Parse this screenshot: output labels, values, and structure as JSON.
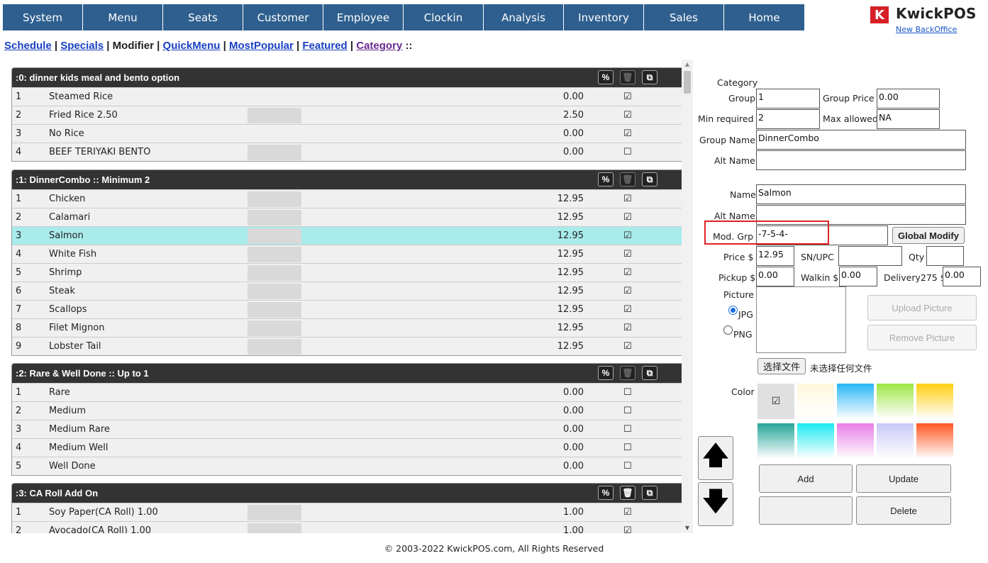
{
  "nav": [
    "System",
    "Menu",
    "Seats",
    "Customer",
    "Employee",
    "Clockin",
    "Analysis",
    "Inventory",
    "Sales",
    "Home"
  ],
  "logo": {
    "mark": "K",
    "name": "KwickPOS",
    "link": "New BackOffice"
  },
  "subnav": {
    "schedule": "Schedule",
    "specials": "Specials",
    "modifier": "Modifier",
    "quickmenu": "QuickMenu",
    "mostpopular": "MostPopular",
    "featured": "Featured",
    "category": "Category",
    "sep": "|",
    "tail": "::"
  },
  "groups": [
    {
      "title": ":0: dinner kids meal and bento option",
      "trash_enabled": false,
      "rows": [
        {
          "num": "1",
          "name": "Steamed Rice",
          "price": "0.00",
          "checked": true,
          "swatch": false
        },
        {
          "num": "2",
          "name": "Fried Rice 2.50",
          "price": "2.50",
          "checked": true,
          "swatch": true
        },
        {
          "num": "3",
          "name": "No Rice",
          "price": "0.00",
          "checked": true,
          "swatch": false
        },
        {
          "num": "4",
          "name": "BEEF TERIYAKI BENTO",
          "price": "0.00",
          "checked": false,
          "swatch": true
        }
      ]
    },
    {
      "title": ":1: DinnerCombo :: Minimum 2",
      "trash_enabled": false,
      "rows": [
        {
          "num": "1",
          "name": "Chicken",
          "price": "12.95",
          "checked": true,
          "swatch": true
        },
        {
          "num": "2",
          "name": "Calamari",
          "price": "12.95",
          "checked": true,
          "swatch": true
        },
        {
          "num": "3",
          "name": "Salmon",
          "price": "12.95",
          "checked": true,
          "swatch": true,
          "selected": true
        },
        {
          "num": "4",
          "name": "White Fish",
          "price": "12.95",
          "checked": true,
          "swatch": true
        },
        {
          "num": "5",
          "name": "Shrimp",
          "price": "12.95",
          "checked": true,
          "swatch": true
        },
        {
          "num": "6",
          "name": "Steak",
          "price": "12.95",
          "checked": true,
          "swatch": true
        },
        {
          "num": "7",
          "name": "Scallops",
          "price": "12.95",
          "checked": true,
          "swatch": true
        },
        {
          "num": "8",
          "name": "Filet Mignon",
          "price": "12.95",
          "checked": true,
          "swatch": true
        },
        {
          "num": "9",
          "name": "Lobster Tail",
          "price": "12.95",
          "checked": true,
          "swatch": true
        }
      ]
    },
    {
      "title": ":2: Rare & Well Done :: Up to 1",
      "trash_enabled": false,
      "rows": [
        {
          "num": "1",
          "name": "Rare",
          "price": "0.00",
          "checked": false,
          "swatch": false
        },
        {
          "num": "2",
          "name": "Medium",
          "price": "0.00",
          "checked": false,
          "swatch": false
        },
        {
          "num": "3",
          "name": "Medium Rare",
          "price": "0.00",
          "checked": false,
          "swatch": false
        },
        {
          "num": "4",
          "name": "Medium Well",
          "price": "0.00",
          "checked": false,
          "swatch": false
        },
        {
          "num": "5",
          "name": "Well Done",
          "price": "0.00",
          "checked": false,
          "swatch": false
        }
      ]
    },
    {
      "title": ":3: CA Roll Add On",
      "trash_enabled": true,
      "rows": [
        {
          "num": "1",
          "name": "Soy Paper(CA Roll) 1.00",
          "price": "1.00",
          "checked": true,
          "swatch": true
        },
        {
          "num": "2",
          "name": "Avocado(CA Roll) 1.00",
          "price": "1.00",
          "checked": true,
          "swatch": true
        }
      ]
    }
  ],
  "form": {
    "category_label": "Category",
    "group_label": "Group",
    "group_value": "1",
    "group_price_label": "Group Price",
    "group_price_value": "0.00",
    "min_label": "Min required",
    "min_value": "2",
    "max_label": "Max allowed",
    "max_value": "NA",
    "group_name_label": "Group Name",
    "group_name_value": "DinnerCombo",
    "alt_name_label": "Alt Name",
    "alt_name_value": "",
    "name_label": "Name",
    "name_value": "Salmon",
    "alt_name2_label": "Alt Name",
    "alt_name2_value": "",
    "modgrp_label": "Mod. Grp",
    "modgrp_value": "-7-5-4-",
    "global_modify": "Global Modify",
    "price_label": "Price $",
    "price_value": "12.95",
    "sn_label": "SN/UPC",
    "sn_value": "",
    "qty_label": "Qty",
    "qty_value": "",
    "pickup_label": "Pickup $",
    "pickup_value": "0.00",
    "walkin_label": "Walkin $",
    "walkin_value": "0.00",
    "delivery_label": "Delivery275 $",
    "delivery_value": "0.00",
    "picture_label": "Picture",
    "jpg_label": "JPG",
    "png_label": "PNG",
    "upload_picture": "Upload Picture",
    "remove_picture": "Remove Picture",
    "choose_file": "选择文件",
    "no_file": "未选择任何文件",
    "color_label": "Color",
    "add": "Add",
    "update": "Update",
    "delete": "Delete"
  },
  "colors": [
    {
      "name": "none-selected",
      "top": "#e0e0e0",
      "bottom": "#e0e0e0"
    },
    {
      "name": "cream",
      "top": "#fff7dc",
      "bottom": "#ffffff"
    },
    {
      "name": "sky-blue",
      "top": "#29b6f6",
      "bottom": "#ffffff"
    },
    {
      "name": "lime",
      "top": "#9ee645",
      "bottom": "#ffffff"
    },
    {
      "name": "yellow",
      "top": "#ffcf12",
      "bottom": "#ffffff"
    },
    {
      "name": "teal",
      "top": "#26a69a",
      "bottom": "#ffffff"
    },
    {
      "name": "cyan",
      "top": "#1de9f0",
      "bottom": "#ffffff"
    },
    {
      "name": "pink",
      "top": "#e87de5",
      "bottom": "#ffffff"
    },
    {
      "name": "lavender",
      "top": "#c9c9f7",
      "bottom": "#ffffff"
    },
    {
      "name": "orange-red",
      "top": "#ff5722",
      "bottom": "#ffffff"
    }
  ],
  "footer": "© 2003-2022 KwickPOS.com, All Rights Reserved"
}
